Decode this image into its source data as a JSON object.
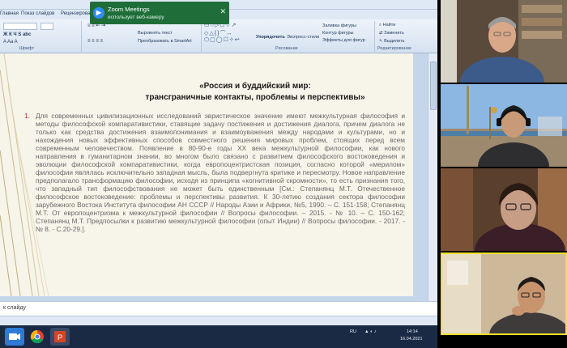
{
  "ppt": {
    "tabs": [
      "Главная",
      "Показ слайдов",
      "Рецензирование"
    ],
    "ribbon": {
      "group_font": "Шрифт",
      "group_drawing": "Рисование",
      "group_editing": "Редактирование",
      "find": "Найти",
      "replace": "Заменить",
      "select": "Выделить",
      "arrange": "Упорядочить",
      "quick_styles": "Экспресс-стили",
      "fill": "Заливка фигуры",
      "outline": "Контур фигуры",
      "effects": "Эффекты для фигур",
      "align_text": "Выровнять текст",
      "smartart": "Преобразовать в SmartArt"
    },
    "slide": {
      "title_line1": "«Россия и буддийский мир:",
      "title_line2": "трансграничные контакты, проблемы и перспективы»",
      "item_number": "1.",
      "body_text": "Для современных цивилизационных исследований эвристическое значение имеют межкультурная философия и методы философской компаративистики, ставящие задачу постижения и достижения диалога, причем диалога не только как средства достижения взаимопонимания и взаимоуважения между народами и культурами, но и нахождения новых эффективных способов совместного решения мировых проблем, стоящих перед всем современным человечеством. Появление в 80-90-е годы XX века межкультурной философии, как нового направления в гуманитарном знании, во многом было связано с развитием философского востоковедения и эволюции философской компаративистики, когда европоцентристская позиция, согласно которой «мерилом» философии являлась исключительно западная мысль, была подвергнута критике и пересмотру. Новое направление предполагало трансформацию философии, исходя из принципа «когнитивной скромности», то есть признания того, что западный тип философствования не может быть единственным [См.: Степанянц М.Т. Отечественное философское востоковедение: проблемы и перспективы развития. К 30-летию создания сектора философии зарубежного Востока Института философии АН СССР // Народы Азии и Африки, №5, 1990. – С. 151-158; Степанянц М.Т. От европоцентризма к межкультурной философии // Вопросы философии. – 2015. - № 10. – С. 150-162; Степанянц М.Т. Предпосылки к развитию межкультурной философии (опыт Индии) // Вопросы философии. - 2017. - № 8. - С.20-29.]."
    },
    "notes_placeholder": "к слайду"
  },
  "zoom_toast": {
    "title": "Zoom Meetings",
    "message": "использует веб-камеру",
    "close": "✕"
  },
  "tray": {
    "lang": "RU",
    "time": "14:14",
    "date": "16.04.2021"
  },
  "colors": {
    "ribbon_bg": "#dfe9f5",
    "slide_bg": "#f7f4ea",
    "active_speaker": "#f3e02c",
    "zoom_toast": "#1f6e3a"
  },
  "participants": [
    {
      "name": "participant-1",
      "scene": "bookshelf-room"
    },
    {
      "name": "participant-2",
      "scene": "outdoor-headphones"
    },
    {
      "name": "participant-3",
      "scene": "indoor-glasses"
    },
    {
      "name": "participant-4",
      "scene": "indoor-active-speaker"
    }
  ]
}
